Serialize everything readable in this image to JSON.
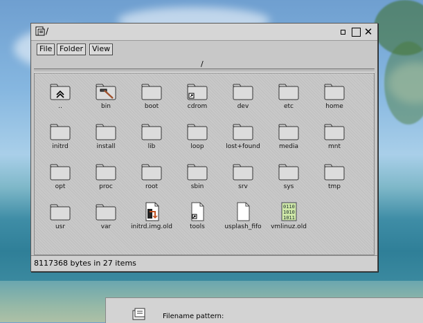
{
  "window": {
    "title": "/",
    "path": "/",
    "menus": [
      "File",
      "Folder",
      "View"
    ],
    "status": "8117368 bytes in 27 items"
  },
  "items": [
    {
      "name": "..",
      "icon": "up-folder-icon"
    },
    {
      "name": "bin",
      "icon": "folder-hammer-icon"
    },
    {
      "name": "boot",
      "icon": "folder-icon"
    },
    {
      "name": "cdrom",
      "icon": "folder-link-icon"
    },
    {
      "name": "dev",
      "icon": "folder-icon"
    },
    {
      "name": "etc",
      "icon": "folder-icon"
    },
    {
      "name": "home",
      "icon": "folder-icon"
    },
    {
      "name": "initrd",
      "icon": "folder-icon"
    },
    {
      "name": "install",
      "icon": "folder-icon"
    },
    {
      "name": "lib",
      "icon": "folder-icon"
    },
    {
      "name": "loop",
      "icon": "folder-icon"
    },
    {
      "name": "lost+found",
      "icon": "folder-icon"
    },
    {
      "name": "media",
      "icon": "folder-icon"
    },
    {
      "name": "mnt",
      "icon": "folder-icon"
    },
    {
      "name": "opt",
      "icon": "folder-icon"
    },
    {
      "name": "proc",
      "icon": "folder-icon"
    },
    {
      "name": "root",
      "icon": "folder-icon"
    },
    {
      "name": "sbin",
      "icon": "folder-icon"
    },
    {
      "name": "srv",
      "icon": "folder-icon"
    },
    {
      "name": "sys",
      "icon": "folder-icon"
    },
    {
      "name": "tmp",
      "icon": "folder-icon"
    },
    {
      "name": "usr",
      "icon": "folder-icon"
    },
    {
      "name": "var",
      "icon": "folder-icon"
    },
    {
      "name": "initrd.img.old",
      "icon": "file-symlink-icon"
    },
    {
      "name": "tools",
      "icon": "file-link-icon"
    },
    {
      "name": "usplash_fifo",
      "icon": "file-icon"
    },
    {
      "name": "vmlinuz.old",
      "icon": "binary-file-icon"
    }
  ],
  "dialog": {
    "label": "Filename pattern:"
  }
}
